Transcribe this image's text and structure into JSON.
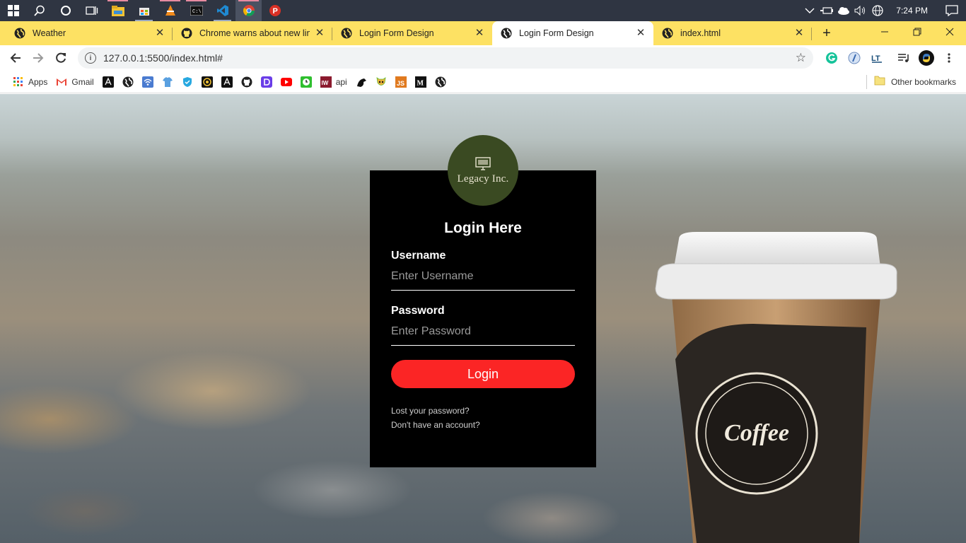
{
  "taskbar": {
    "apps": [
      "start",
      "search",
      "cortana",
      "task-view",
      "file-explorer",
      "store",
      "vlc",
      "terminal",
      "vscode",
      "chrome",
      "pdf-app"
    ],
    "clock": "7:24 PM"
  },
  "tabs": [
    {
      "title": "Weather",
      "active": false
    },
    {
      "title": "Chrome warns about new lines",
      "active": false
    },
    {
      "title": "Login Form Design",
      "active": false
    },
    {
      "title": "Login Form Design",
      "active": true
    },
    {
      "title": "index.html",
      "active": false
    }
  ],
  "address_bar": {
    "url": "127.0.0.1:5500/index.html#"
  },
  "bookmarks": {
    "apps_label": "Apps",
    "gmail_label": "Gmail",
    "api_label": "api",
    "other_label": "Other bookmarks"
  },
  "login": {
    "logo_text": "Legacy Inc.",
    "title": "Login Here",
    "username_label": "Username",
    "username_placeholder": "Enter Username",
    "password_label": "Password",
    "password_placeholder": "Enter Password",
    "button_label": "Login",
    "lost_password": "Lost your password?",
    "no_account": "Don't have an account?"
  },
  "colors": {
    "tabstrip": "#fde163",
    "login_bg": "#000000",
    "login_button": "#fb2525",
    "logo_circle": "#3a4a22"
  }
}
